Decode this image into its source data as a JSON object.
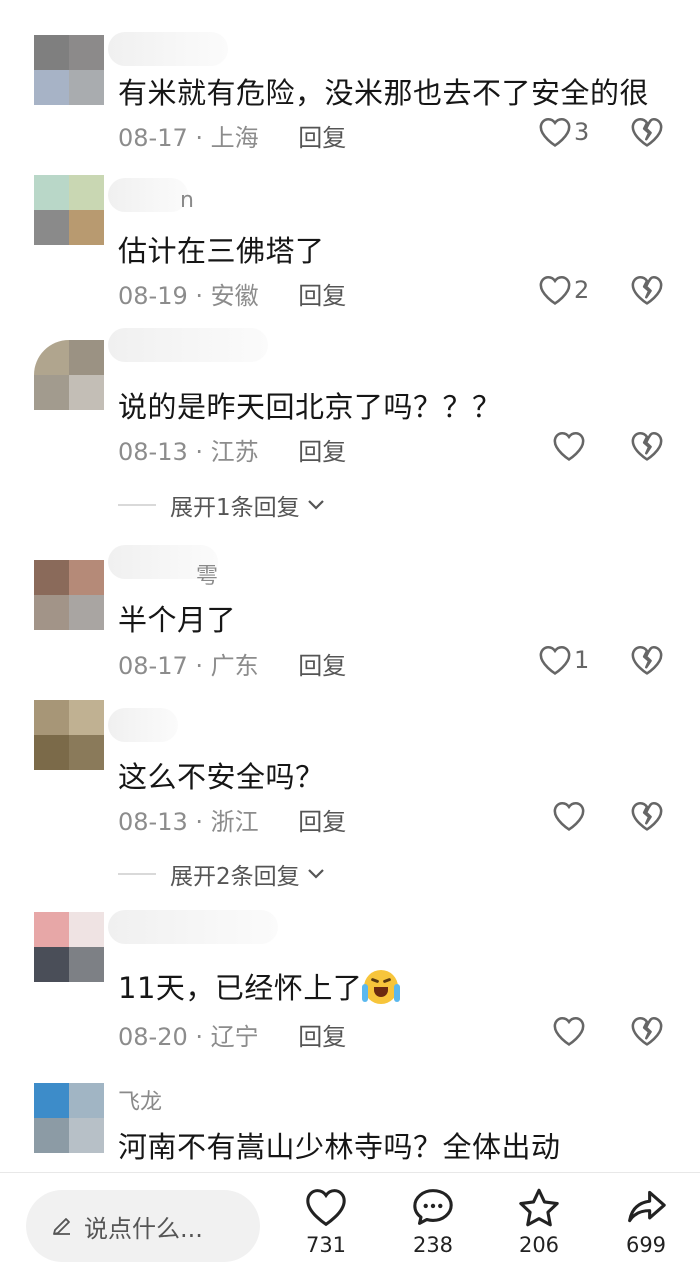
{
  "comments": [
    {
      "avatar_colors": [
        "#7f7f7f",
        "#8c8a8a",
        "#a7b3c6",
        "#a9acaf"
      ],
      "name": "",
      "text": "有米就有危险，没米那也去不了安全的很",
      "date": "08-17",
      "location": "上海",
      "reply": "回复",
      "likes": "3"
    },
    {
      "avatar_colors": [
        "#b9d7c8",
        "#c9d7b3",
        "#8a8a8a",
        "#b89a70"
      ],
      "name": "n",
      "text": "估计在三佛塔了",
      "date": "08-19",
      "location": "安徽",
      "reply": "回复",
      "likes": "2"
    },
    {
      "avatar_colors": [
        "#b0a58e",
        "#9b9283",
        "#a29b8e",
        "#c3beb6"
      ],
      "name": "",
      "text": "说的是昨天回北京了吗？？？",
      "date": "08-13",
      "location": "江苏",
      "reply": "回复",
      "likes": "",
      "expand": "展开1条回复"
    },
    {
      "avatar_colors": [
        "#8a6a5a",
        "#b58a78",
        "#a29488",
        "#a9a5a2"
      ],
      "name": "雩",
      "text": "半个月了",
      "date": "08-17",
      "location": "广东",
      "reply": "回复",
      "likes": "1"
    },
    {
      "avatar_colors": [
        "#a79677",
        "#c0b192",
        "#7b6a49",
        "#8a7a5a"
      ],
      "name": "",
      "text": "这么不安全吗？",
      "date": "08-13",
      "location": "浙江",
      "reply": "回复",
      "likes": "",
      "expand": "展开2条回复"
    },
    {
      "avatar_colors": [
        "#e7a7a7",
        "#efe3e3",
        "#4a4e58",
        "#7d8085"
      ],
      "name": "",
      "text": "11天，已经怀上了",
      "date": "08-20",
      "location": "辽宁",
      "reply": "回复",
      "likes": ""
    },
    {
      "avatar_colors": [
        "#3d8cc9",
        "#a1b5c4",
        "#8c9ba5",
        "#b7c0c7"
      ],
      "name": "飞龙",
      "text": "河南不有嵩山少林寺吗？全体出动",
      "date": "",
      "location": "",
      "reply": "",
      "likes": ""
    }
  ],
  "bottom_bar": {
    "input_placeholder": "说点什么...",
    "likes": "731",
    "comments": "238",
    "favorites": "206",
    "shares": "699"
  }
}
